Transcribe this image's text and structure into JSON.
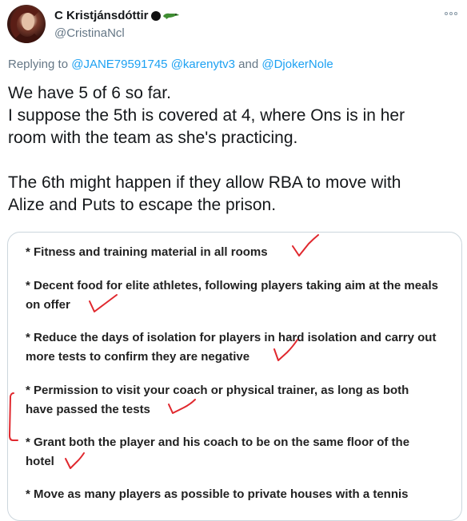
{
  "tweet": {
    "display_name": "C Kristjánsdóttir",
    "handle": "@CristinaNcl",
    "name_emoji_icons": [
      "black-circle-icon",
      "crocodile-icon"
    ],
    "replying_to_prefix": "Replying to",
    "replying_to_mentions": [
      "@JANE79591745",
      "@karenytv3"
    ],
    "replying_to_and": "and",
    "replying_to_last": "@DjokerNole",
    "text_lines": [
      "We have 5 of 6 so far.",
      "I suppose the 5th is covered at 4, where Ons is in her",
      "room with the team as she's practicing.",
      "The 6th might happen if they allow RBA to move with",
      "Alize and Puts to escape the prison."
    ]
  },
  "image": {
    "items": [
      {
        "lines": [
          "* Fitness and training material in all rooms"
        ]
      },
      {
        "lines": [
          "* Decent food for elite athletes, following players taking aim at the meals",
          "on offer"
        ]
      },
      {
        "lines": [
          "* Reduce the days of isolation for players in hard isolation and carry out",
          "more tests to confirm they are negative"
        ]
      },
      {
        "lines": [
          "* Permission to visit your coach or physical trainer, as long as both",
          "have passed the tests"
        ]
      },
      {
        "lines": [
          "* Grant both the player and his coach to be on the same floor of the",
          "hotel"
        ]
      },
      {
        "lines": [
          "* Move as many players as possible to private houses with a tennis"
        ]
      }
    ],
    "annotation_color": "#e0282e",
    "annotations": [
      "checkmark",
      "checkmark",
      "checkmark",
      "checkmark",
      "checkmark",
      "bracket"
    ]
  },
  "colors": {
    "link": "#1da1f2",
    "secondary_text": "#657786",
    "primary_text": "#14171a",
    "border": "#ccd6dd"
  }
}
